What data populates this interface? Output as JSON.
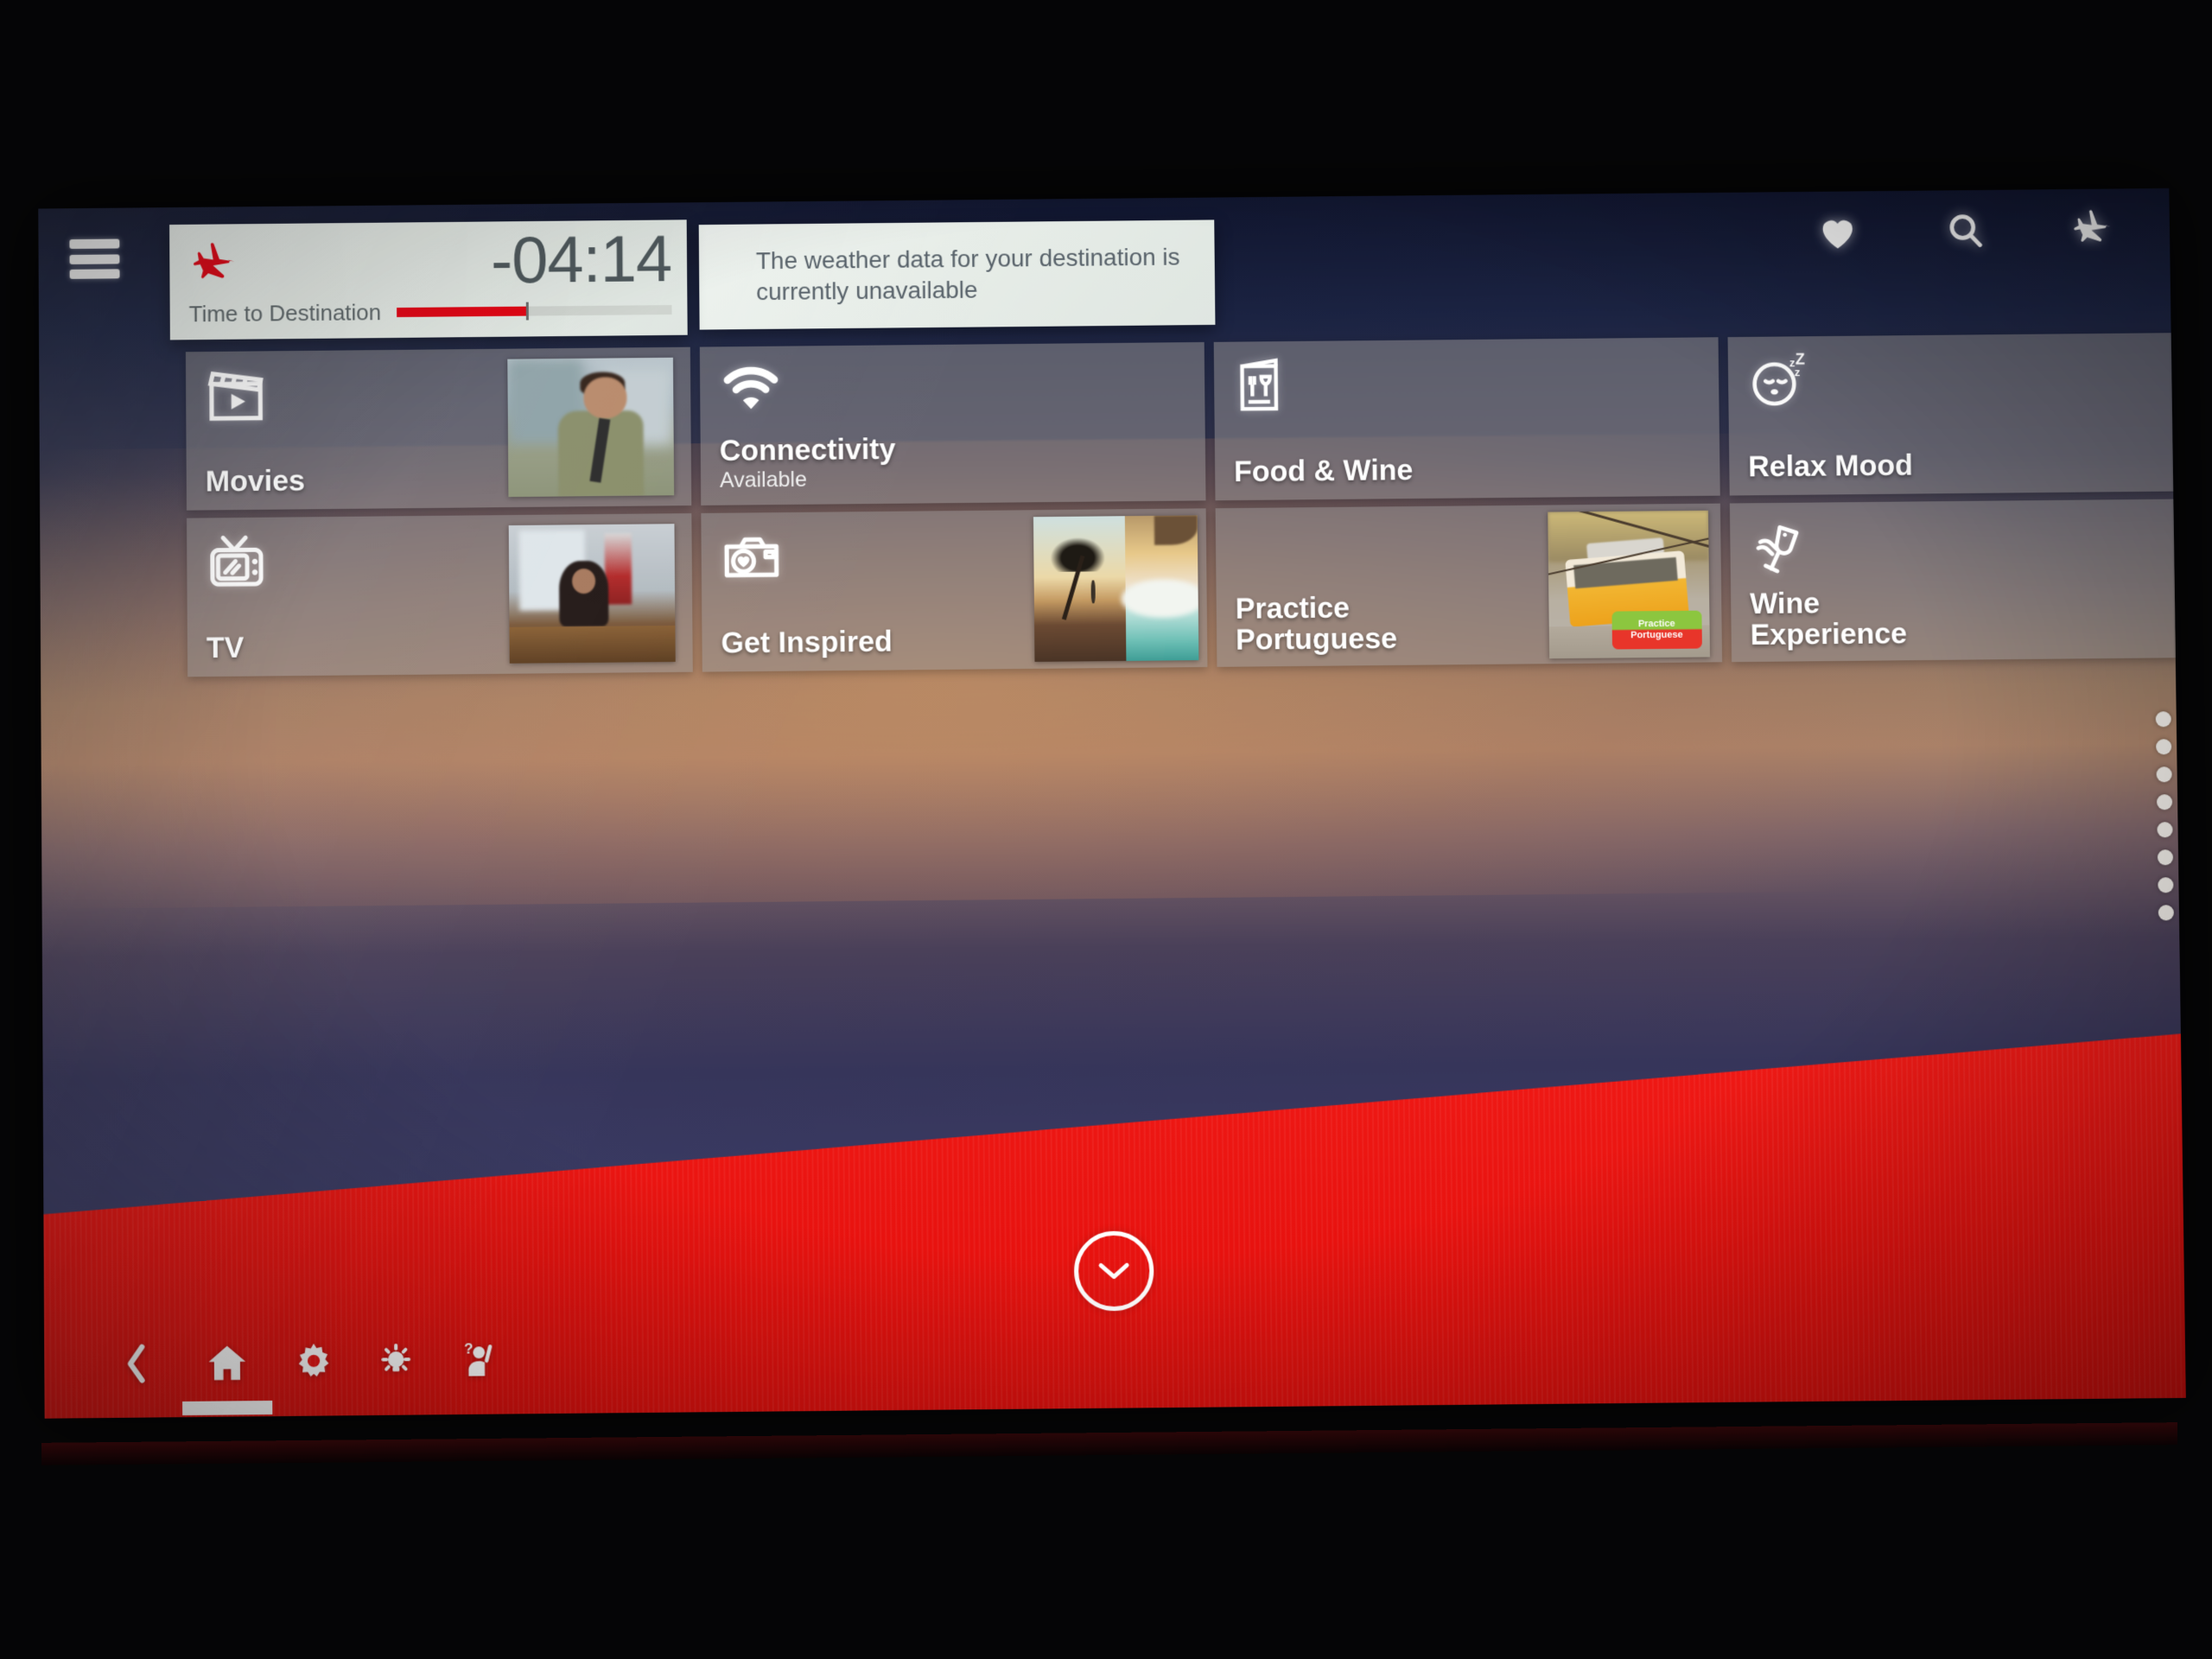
{
  "topbar": {
    "menu_icon": "hamburger-menu-icon",
    "actions": [
      {
        "name": "favorites",
        "icon": "heart-icon"
      },
      {
        "name": "search",
        "icon": "search-icon"
      },
      {
        "name": "flight-map",
        "icon": "airplane-icon"
      }
    ]
  },
  "flight_card": {
    "icon": "airplane-icon",
    "time_remaining": "-04:14",
    "label": "Time to Destination",
    "progress_percent": 47,
    "accent_color": "#e3000f"
  },
  "weather_card": {
    "message": "The weather data for your destination is currently unavailable"
  },
  "tiles": [
    {
      "label": "Movies",
      "icon": "clapperboard-icon",
      "sub": "",
      "thumb": "soldier-still"
    },
    {
      "label": "Connectivity",
      "icon": "wifi-icon",
      "sub": "Available",
      "thumb": ""
    },
    {
      "label": "Food & Wine",
      "icon": "menu-card-icon",
      "sub": "",
      "thumb": ""
    },
    {
      "label": "Relax Mood",
      "icon": "sleeping-face-icon",
      "sub": "",
      "thumb": ""
    },
    {
      "label": "TV",
      "icon": "retro-tv-icon",
      "sub": "",
      "thumb": "courtroom-still"
    },
    {
      "label": "Get Inspired",
      "icon": "camera-heart-icon",
      "sub": "",
      "thumb": "beach-wave-collage"
    },
    {
      "label": "Practice Portuguese",
      "icon": "",
      "sub": "",
      "thumb": "lisbon-tram"
    },
    {
      "label": "Wine Experience",
      "icon": "hand-wine-glass-icon",
      "sub": "",
      "thumb": ""
    }
  ],
  "tile_labels": {
    "movies": "Movies",
    "connectivity": "Connectivity",
    "connectivity_sub": "Available",
    "food_wine": "Food & Wine",
    "relax_mood": "Relax Mood",
    "tv": "TV",
    "get_inspired": "Get Inspired",
    "practice_portuguese_line1": "Practice",
    "practice_portuguese_line2": "Portuguese",
    "wine_experience_line1": "Wine",
    "wine_experience_line2": "Experience"
  },
  "portuguese_badge": {
    "line1": "Practice",
    "line2": "Portuguese"
  },
  "scroll_indicator": {
    "dots": 8
  },
  "scroll_button": {
    "icon": "chevron-down-icon"
  },
  "bottom_nav": {
    "background_color": "#e8120f",
    "items": [
      {
        "name": "back",
        "icon": "chevron-left-icon",
        "active": false
      },
      {
        "name": "home",
        "icon": "home-icon",
        "active": true
      },
      {
        "name": "settings",
        "icon": "gear-icon",
        "active": false
      },
      {
        "name": "reading-light",
        "icon": "lightbulb-icon",
        "active": false
      },
      {
        "name": "call-attendant",
        "icon": "call-attendant-icon",
        "active": false
      }
    ]
  }
}
